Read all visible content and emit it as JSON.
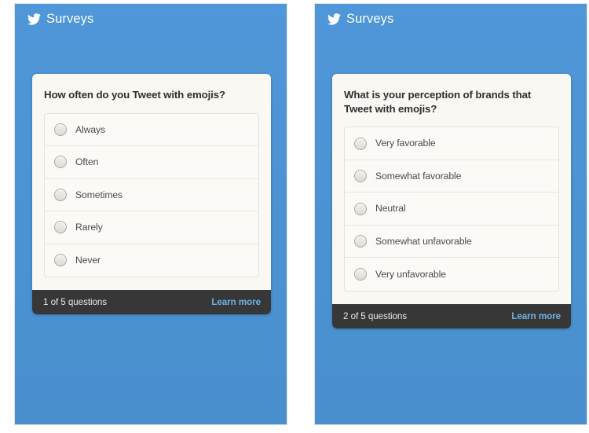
{
  "screens": [
    {
      "name": "survey-question-1",
      "header": {
        "icon": "twitter-bird-icon",
        "title": "Surveys"
      },
      "card": {
        "question": "How often do you Tweet with emojis?",
        "options": [
          {
            "label": "Always",
            "selected": false,
            "icon": "radio-unchecked-icon"
          },
          {
            "label": "Often",
            "selected": false,
            "icon": "radio-unchecked-icon"
          },
          {
            "label": "Sometimes",
            "selected": false,
            "icon": "radio-unchecked-icon"
          },
          {
            "label": "Rarely",
            "selected": false,
            "icon": "radio-unchecked-icon"
          },
          {
            "label": "Never",
            "selected": false,
            "icon": "radio-unchecked-icon"
          }
        ],
        "footer": {
          "progress": "1 of 5 questions",
          "learn_more": "Learn more"
        }
      }
    },
    {
      "name": "survey-question-2",
      "header": {
        "icon": "twitter-bird-icon",
        "title": "Surveys"
      },
      "card": {
        "question": "What is your perception of brands that Tweet with emojis?",
        "options": [
          {
            "label": "Very favorable",
            "selected": false,
            "icon": "radio-unchecked-icon"
          },
          {
            "label": "Somewhat favorable",
            "selected": false,
            "icon": "radio-unchecked-icon"
          },
          {
            "label": "Neutral",
            "selected": false,
            "icon": "radio-unchecked-icon"
          },
          {
            "label": "Somewhat unfavorable",
            "selected": false,
            "icon": "radio-unchecked-icon"
          },
          {
            "label": "Very unfavorable",
            "selected": false,
            "icon": "radio-unchecked-icon"
          }
        ],
        "footer": {
          "progress": "2 of 5 questions",
          "learn_more": "Learn more"
        }
      }
    }
  ],
  "colors": {
    "brand_blue": "#4a92d2",
    "card_background": "#faf8f3",
    "footer_background": "#373737",
    "link_blue": "#6fb4e8",
    "question_text": "#2f2f31",
    "option_text": "#4a4a4c"
  }
}
